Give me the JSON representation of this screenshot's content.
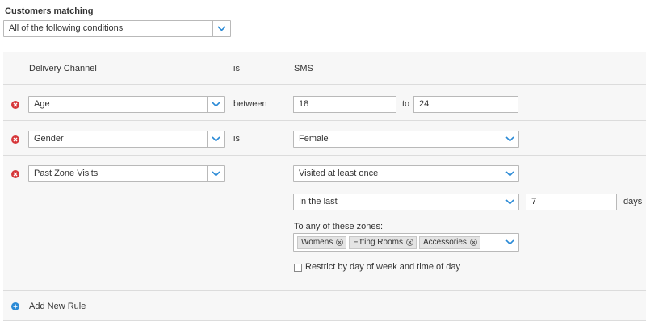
{
  "header": {
    "title": "Customers matching",
    "match_mode": "All of the following conditions"
  },
  "rules": [
    {
      "field": "Delivery Channel",
      "operator": "is",
      "value": "SMS",
      "removable": false
    },
    {
      "field": "Age",
      "operator": "between",
      "min": "18",
      "joiner": "to",
      "max": "24",
      "removable": true
    },
    {
      "field": "Gender",
      "operator": "is",
      "value": "Female",
      "removable": true
    },
    {
      "field": "Past Zone Visits",
      "frequency": "Visited at least once",
      "period": "In the last",
      "period_count": "7",
      "period_unit": "days",
      "zones_label": "To any of these zones:",
      "zones": [
        "Womens",
        "Fitting Rooms",
        "Accessories"
      ],
      "restrict_label": "Restrict by day of week and time of day",
      "restrict_checked": false,
      "removable": true
    }
  ],
  "footer": {
    "add_rule_label": "Add New Rule"
  },
  "colors": {
    "accent": "#2b8ad6",
    "remove": "#d6373a",
    "panel": "#f7f7f7",
    "border": "#b9b9b9"
  },
  "icons": {
    "dropdown": "chevron-down-icon",
    "remove": "remove-circle-icon",
    "add": "add-circle-icon",
    "chip_remove": "close-icon"
  }
}
